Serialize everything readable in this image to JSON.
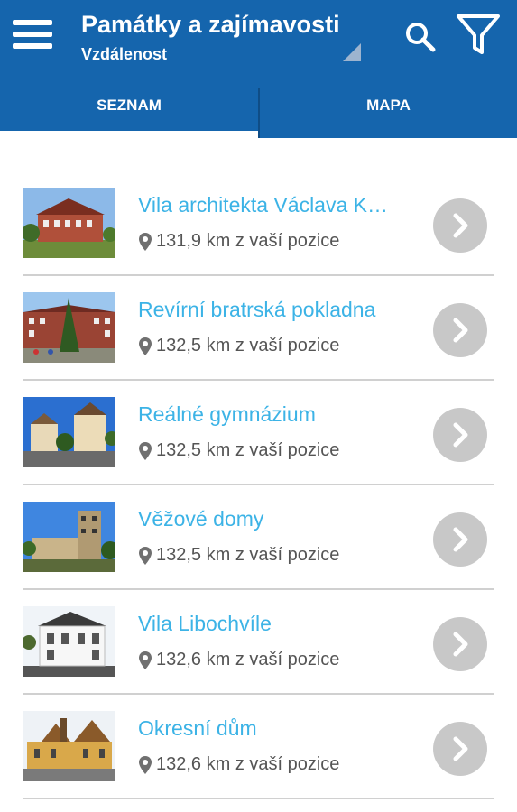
{
  "header": {
    "title": "Památky a zajímavosti",
    "subtitle": "Vzdálenost",
    "menu_icon": "menu-icon",
    "search_icon": "search-icon",
    "filter_icon": "filter-icon",
    "bar_color": "#1565ad"
  },
  "tabs": [
    {
      "label": "SEZNAM",
      "active": true
    },
    {
      "label": "MAPA",
      "active": false
    }
  ],
  "places": [
    {
      "title": "Vila architekta Václava Kocourka",
      "distance": "131,9 km z vaší pozice",
      "thumb": "villa-red-brick"
    },
    {
      "title": "Revírní bratrská pokladna",
      "distance": "132,5 km z vaší pozice",
      "thumb": "building-with-tree"
    },
    {
      "title": "Reálné gymnázium",
      "distance": "132,5 km z vaší pozice",
      "thumb": "gymnasium-towers"
    },
    {
      "title": "Věžové domy",
      "distance": "132,5 km z vaší pozice",
      "thumb": "tower-houses"
    },
    {
      "title": "Vila Libochvíle",
      "distance": "132,6 km z vaší pozice",
      "thumb": "white-villa"
    },
    {
      "title": "Okresní dům",
      "distance": "132,6 km z vaší pozice",
      "thumb": "district-house"
    }
  ],
  "colors": {
    "title_link": "#3cb3e6",
    "distance_text": "#555555",
    "chevron_bg": "#c8c8c8"
  }
}
